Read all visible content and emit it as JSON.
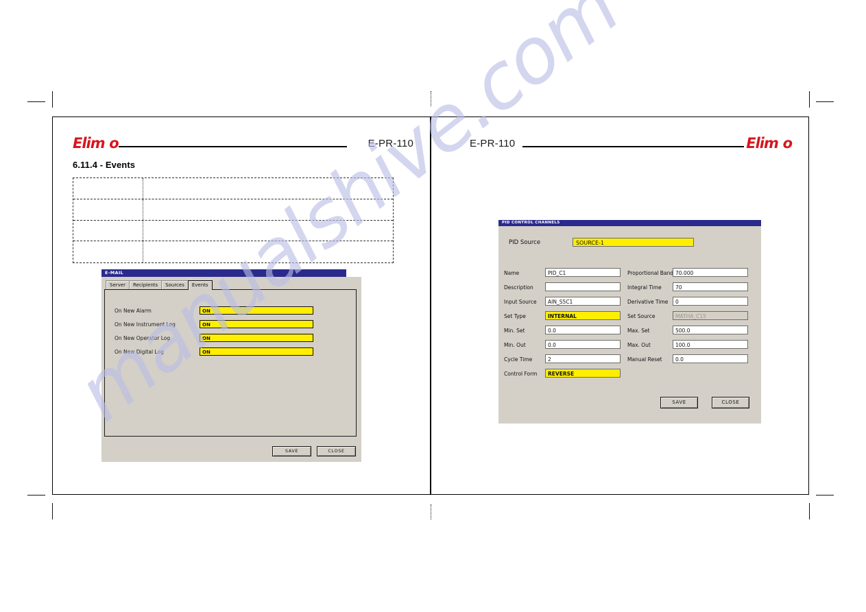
{
  "document": {
    "brand": "Elimko",
    "doc_code": "E-PR-110"
  },
  "left_page": {
    "section_title": "6.11.4 - Events",
    "spec_table": {
      "rows": [
        {
          "label": "",
          "value": ""
        },
        {
          "label": "",
          "value": ""
        },
        {
          "label": "",
          "value": ""
        },
        {
          "label": "",
          "value": ""
        }
      ]
    },
    "email_dialog": {
      "title": "E-MAIL",
      "tabs": [
        {
          "label": "Server",
          "active": false
        },
        {
          "label": "Recipients",
          "active": false
        },
        {
          "label": "Sources",
          "active": false
        },
        {
          "label": "Events",
          "active": true
        }
      ],
      "events": [
        {
          "label": "On New Alarm",
          "value": "ON"
        },
        {
          "label": "On New Instrument Log",
          "value": "ON"
        },
        {
          "label": "On New Operator Log",
          "value": "ON"
        },
        {
          "label": "On New Digital Log",
          "value": "ON"
        }
      ],
      "buttons": {
        "save": "SAVE",
        "close": "CLOSE"
      }
    }
  },
  "right_page": {
    "pid_dialog": {
      "title": "PID CONTROL CHANNELS",
      "source": {
        "label": "PID Source",
        "value": "SOURCE-1"
      },
      "fields_left": [
        {
          "label": "Name",
          "value": "PID_C1",
          "style": "normal"
        },
        {
          "label": "Description",
          "value": "",
          "style": "normal"
        },
        {
          "label": "Input Source",
          "value": "AIN_S5C1",
          "style": "normal"
        },
        {
          "label": "Set Type",
          "value": "INTERNAL",
          "style": "yellow"
        },
        {
          "label": "Min. Set",
          "value": "0.0",
          "style": "normal"
        },
        {
          "label": "Min. Out",
          "value": "0.0",
          "style": "normal"
        },
        {
          "label": "Cycle Time",
          "value": "2",
          "style": "normal"
        },
        {
          "label": "Control Form",
          "value": "REVERSE",
          "style": "yellow"
        }
      ],
      "fields_right": [
        {
          "label": "Proportional Band",
          "value": "70.000",
          "style": "normal"
        },
        {
          "label": "Integral Time",
          "value": "70",
          "style": "normal"
        },
        {
          "label": "Derivative Time",
          "value": "0",
          "style": "normal"
        },
        {
          "label": "Set Source",
          "value": "MATHA_C15",
          "style": "disabled"
        },
        {
          "label": "Max. Set",
          "value": "500.0",
          "style": "normal"
        },
        {
          "label": "Max. Out",
          "value": "100.0",
          "style": "normal"
        },
        {
          "label": "Manual Reset",
          "value": "0.0",
          "style": "normal"
        }
      ],
      "buttons": {
        "save": "SAVE",
        "close": "CLOSE"
      }
    }
  },
  "watermark": {
    "text": "manualshive.com"
  },
  "colors": {
    "brand_red": "#d7171f",
    "titlebar_blue": "#2a2a8c",
    "field_yellow": "#ffee00",
    "dialog_gray": "#d4d0c8"
  }
}
